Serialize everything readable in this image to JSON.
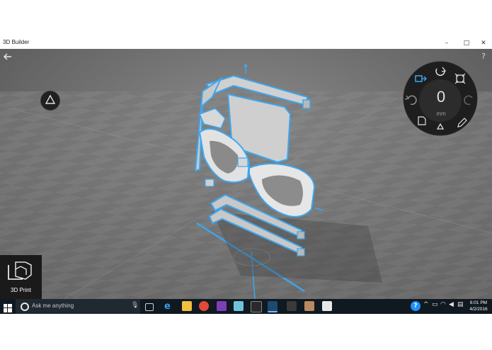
{
  "window": {
    "title": "3D Builder",
    "minimize": "–",
    "maximize": "□",
    "close": "✕"
  },
  "app": {
    "help": "?",
    "print_label": "3D Print",
    "dial": {
      "value": "0",
      "unit": "mm"
    }
  },
  "taskbar": {
    "search_placeholder": "Ask me anything",
    "clock_time": "6:01 PM",
    "clock_date": "4/2/2016",
    "accent": "#1e90ff"
  },
  "colors": {
    "selection": "#3ba7f0",
    "viewport_bg": "#6a6a6a",
    "dial_bg": "#1e1e1e"
  }
}
